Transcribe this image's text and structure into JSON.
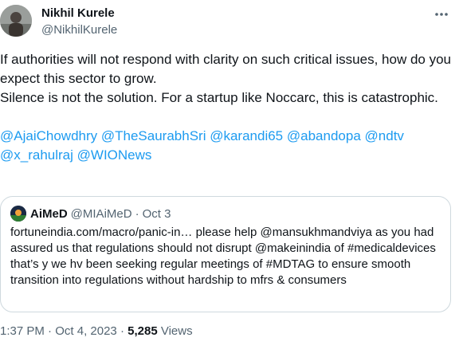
{
  "author": {
    "display_name": "Nikhil Kurele",
    "handle": "@NikhilKurele"
  },
  "more_icon": "more-horizontal-icon",
  "tweet": {
    "line1": "If authorities will not respond with clarity on such critical issues, how do you expect this sector to grow.",
    "line2": "Silence is not the solution. For a startup like Noccarc, this is catastrophic.",
    "mentions": [
      "@AjaiChowdhry",
      "@TheSaurabhSri",
      "@karandi65",
      "@abandopa",
      "@ndtv",
      "@x_rahulraj",
      "@WIONews"
    ]
  },
  "quote": {
    "display_name": "AiMeD",
    "handle": "@MIAiMeD",
    "separator": "·",
    "date": "Oct 3",
    "text": "fortuneindia.com/macro/panic-in… please help @mansukhmandviya as you had assured us that regulations should not disrupt @makeinindia of #medicaldevices that’s y we hv been seeking regular meetings of #MDTAG to ensure smooth transition into regulations without hardship to mfrs & consumers"
  },
  "meta": {
    "time": "1:37 PM",
    "sep1": " · ",
    "date": "Oct 4, 2023",
    "sep2": " · ",
    "views_count": "5,285",
    "views_label": " Views"
  },
  "colors": {
    "text": "#0f1419",
    "muted": "#536471",
    "link": "#1d9bf0",
    "border": "#cfd9de"
  }
}
